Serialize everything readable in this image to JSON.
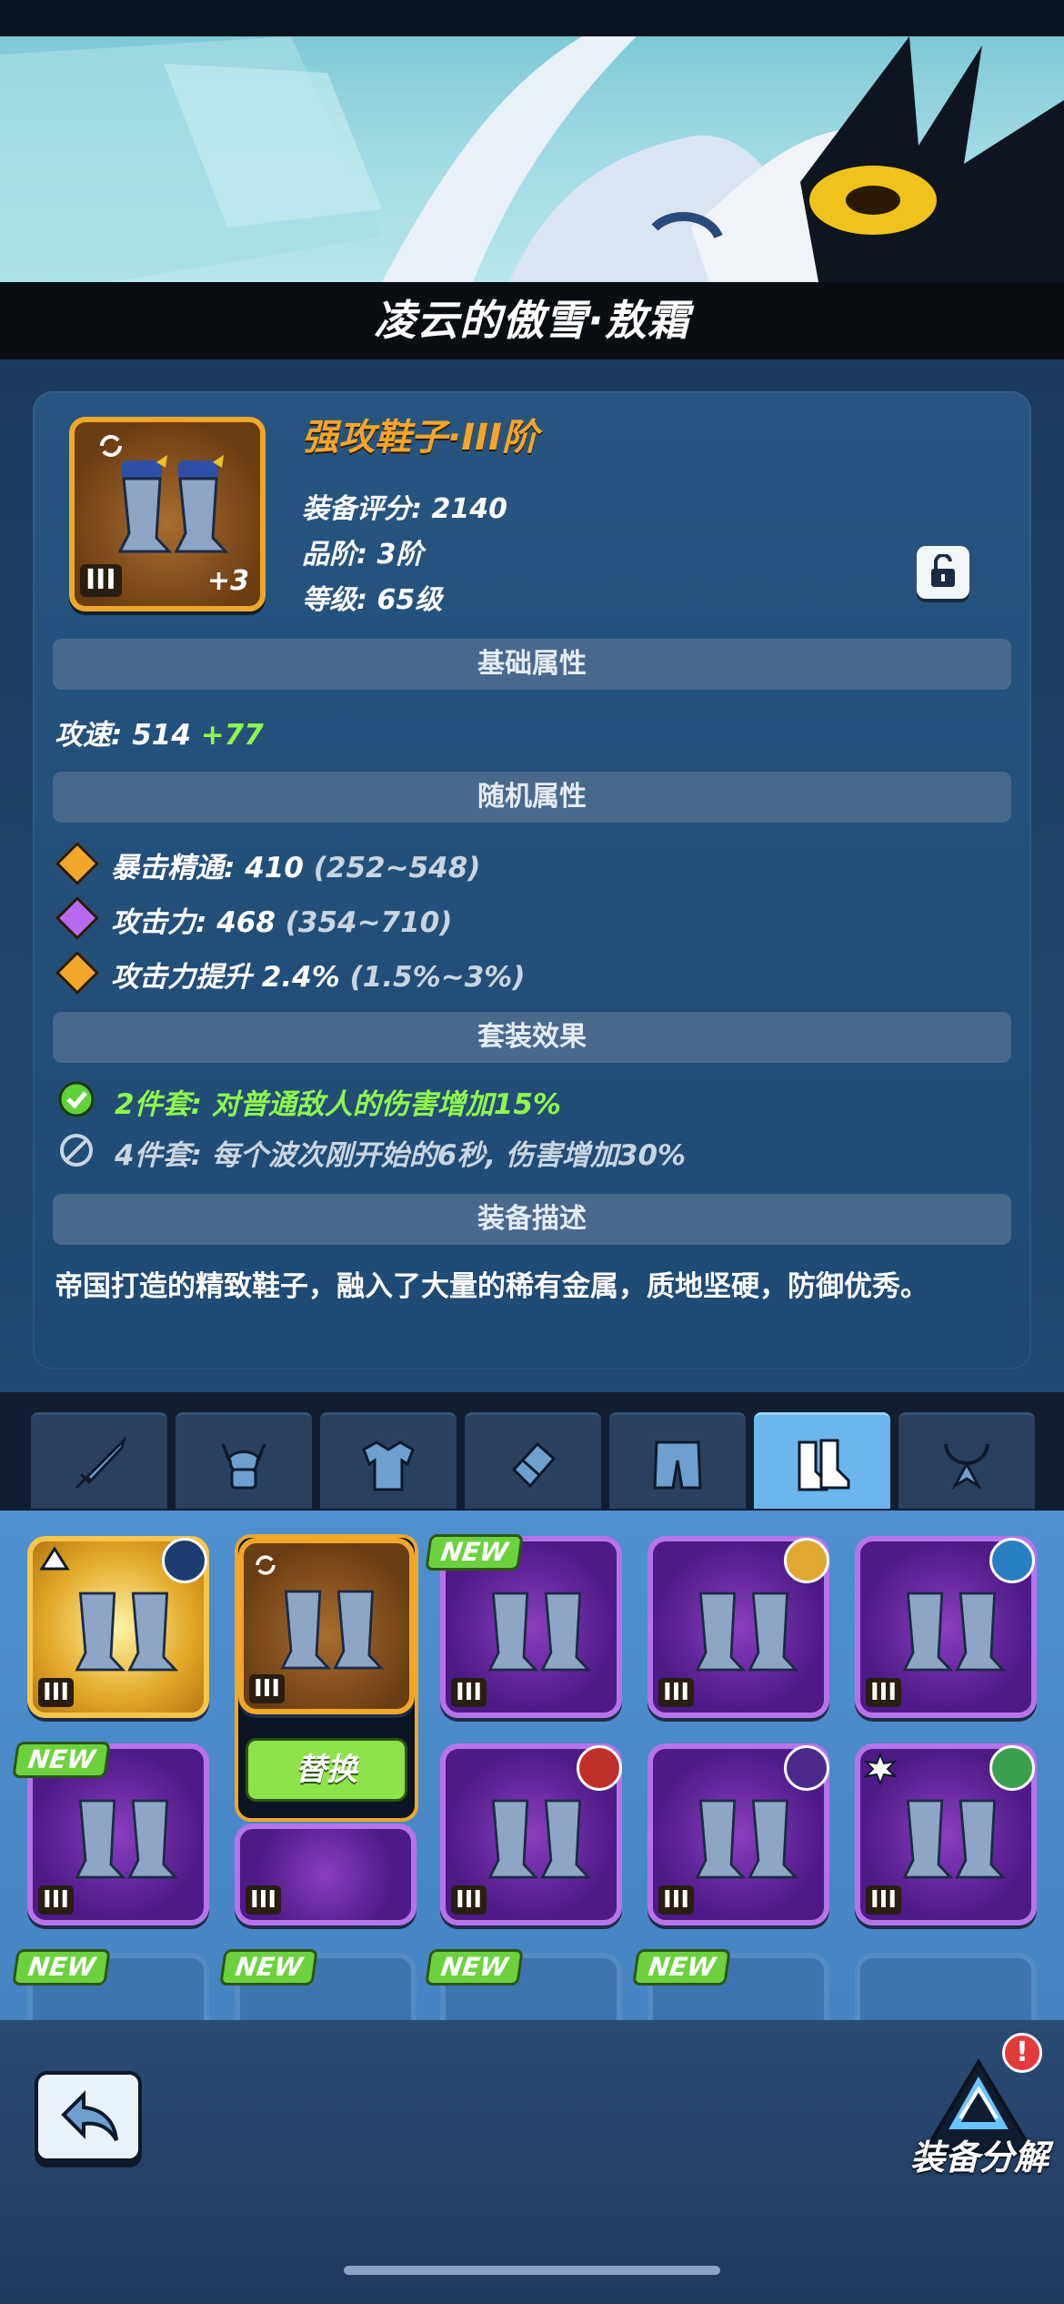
{
  "header": {
    "title": "凌云的傲雪·敖霜"
  },
  "item": {
    "name": "强攻鞋子·III阶",
    "score_label": "装备评分: 2140",
    "grade_label": "品阶: 3阶",
    "level_label": "等级: 65级",
    "tier_badge": "III",
    "enhance": "+3"
  },
  "sections": {
    "base": "基础属性",
    "random": "随机属性",
    "set": "套装效果",
    "desc": "装备描述"
  },
  "base_attr": {
    "label": "攻速: 514",
    "bonus": "+77"
  },
  "random_attrs": [
    {
      "label": "暴击精通: 410",
      "range": "(252~548)",
      "color": "#f0a72a"
    },
    {
      "label": "攻击力: 468",
      "range": "(354~710)",
      "color": "#b56af0"
    },
    {
      "label": "攻击力提升 2.4%",
      "range": "(1.5%~3%)",
      "color": "#f0a72a"
    }
  ],
  "set_effects": [
    {
      "text": "2件套: 对普通敌人的伤害增加15%",
      "active": true
    },
    {
      "text": "4件套: 每个波次刚开始的6秒, 伤害增加30%",
      "active": false
    }
  ],
  "description": "帝国打造的精致鞋子，融入了大量的稀有金属，质地坚硬，防御优秀。",
  "tabs": [
    {
      "icon": "sword-icon"
    },
    {
      "icon": "helmet-icon"
    },
    {
      "icon": "armor-icon"
    },
    {
      "icon": "gauntlet-icon"
    },
    {
      "icon": "pants-icon"
    },
    {
      "icon": "boots-icon",
      "active": true
    },
    {
      "icon": "necklace-icon"
    }
  ],
  "grid": {
    "tier": "III",
    "new_tag": "NEW",
    "replace_label": "替换"
  },
  "footer": {
    "salvage_label": "装备分解",
    "salvage_alert": "!"
  },
  "colors": {
    "accent_gold": "#f0a72a",
    "epic_purple": "#b774ea",
    "new_green": "#6bd23d"
  }
}
